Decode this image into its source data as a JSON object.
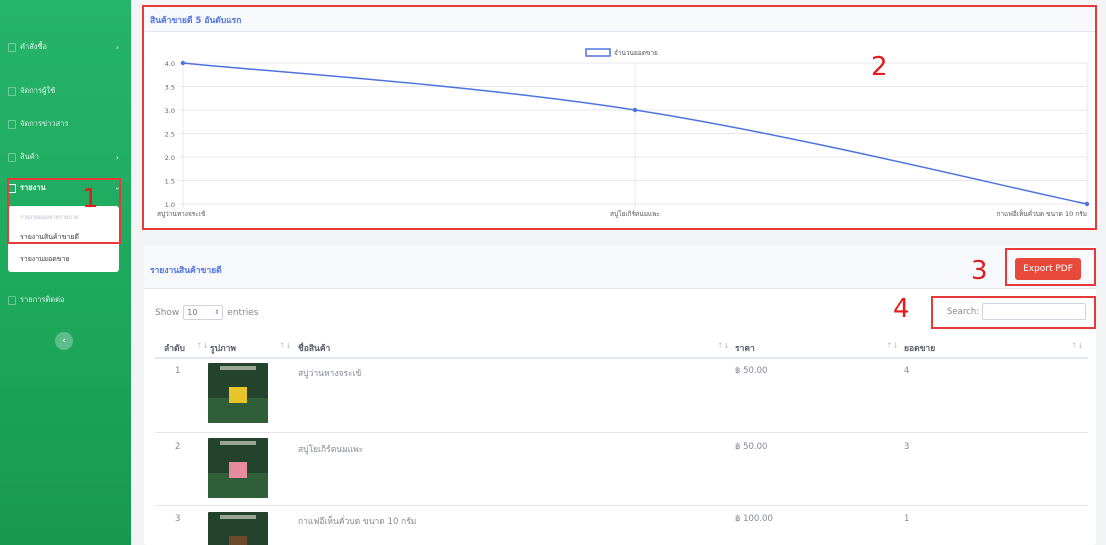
{
  "sidebar": {
    "items": [
      {
        "label": "คำสั่งซื้อ",
        "has_chevron": true
      },
      {
        "label": "จัดการผู้ใช้",
        "has_chevron": false
      },
      {
        "label": "จัดการข่าวสาร",
        "has_chevron": false
      },
      {
        "label": "สินค้า",
        "has_chevron": true
      },
      {
        "label": "รายงาน",
        "has_chevron": true,
        "active": true
      },
      {
        "label": "รายการติดต่อ",
        "has_chevron": false
      }
    ],
    "submenu": {
      "header": "รายงานยอดขายรายภาค",
      "items": [
        "รายงานสินค้าขายดี",
        "รายงานยอดขาย"
      ]
    },
    "collapse_icon": "‹"
  },
  "chart_card": {
    "title": "สินค้าขายดี 5 อันดับแรก"
  },
  "chart_data": {
    "type": "line",
    "categories": [
      "สบู่ว่านหางจระเข้",
      "สบู่โยเกิร์ตนมแพะ",
      "กาแฟอีเห็นคั่วบด ขนาด 10 กรัม"
    ],
    "series": [
      {
        "name": "จำนวนยอดขาย",
        "values": [
          4,
          3,
          1
        ],
        "color": "#4e73df"
      }
    ],
    "ylim": [
      1.0,
      4.0
    ],
    "yticks": [
      "4.0",
      "3.5",
      "3.0",
      "2.5",
      "2.0",
      "1.5",
      "1.0"
    ],
    "grid": true,
    "legend": "top-center",
    "xlabel": "",
    "ylabel": ""
  },
  "report": {
    "title": "รายงานสินค้าขายดี",
    "export_label": "Export PDF",
    "show_prefix": "Show",
    "show_value": "10",
    "show_suffix": "entries",
    "search_label": "Search:",
    "columns": [
      "ลำดับ",
      "รูปภาพ",
      "ชื่อสินค้า",
      "ราคา",
      "ยอดขาย"
    ],
    "rows": [
      {
        "rank": "1",
        "name": "สบู่ว่านหางจระเข้",
        "price": "฿ 50.00",
        "sales": "4",
        "thumb_color": "#e8c62a"
      },
      {
        "rank": "2",
        "name": "สบู่โยเกิร์ตนมแพะ",
        "price": "฿ 50.00",
        "sales": "3",
        "thumb_color": "#e88aa0"
      },
      {
        "rank": "3",
        "name": "กาแฟอีเห็นคั่วบด ขนาด 10 กรัม",
        "price": "฿ 100.00",
        "sales": "1",
        "thumb_color": "#6b4a2a"
      }
    ]
  },
  "annotations": [
    "1",
    "2",
    "3",
    "4"
  ],
  "colors": {
    "sidebar_green": "#1ea85c",
    "accent_blue": "#4e73df",
    "danger_red": "#e74a3b",
    "annotation_red": "#e63a3a"
  }
}
